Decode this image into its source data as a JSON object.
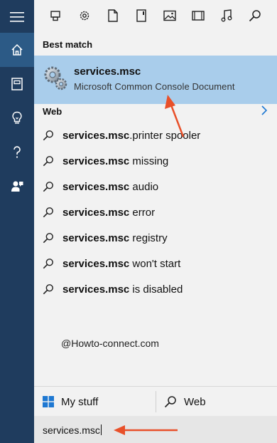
{
  "rail": {
    "items": [
      {
        "icon": "hamburger-menu-icon"
      },
      {
        "icon": "home-icon"
      },
      {
        "icon": "notebook-icon"
      },
      {
        "icon": "lightbulb-icon"
      },
      {
        "icon": "help-icon"
      },
      {
        "icon": "feedback-icon"
      }
    ]
  },
  "filters": [
    "apps-icon",
    "settings-icon",
    "documents-icon",
    "folders-icon",
    "photos-icon",
    "videos-icon",
    "music-icon",
    "search-icon"
  ],
  "best_match": {
    "label": "Best match",
    "title": "services.msc",
    "subtitle": "Microsoft Common Console Document"
  },
  "web": {
    "label": "Web",
    "suggestions": [
      {
        "bold": "services.msc",
        "rest": ".printer spooler"
      },
      {
        "bold": "services.msc",
        "rest": " missing"
      },
      {
        "bold": "services.msc",
        "rest": " audio"
      },
      {
        "bold": "services.msc",
        "rest": " error"
      },
      {
        "bold": "services.msc",
        "rest": " registry"
      },
      {
        "bold": "services.msc",
        "rest": " won't start"
      },
      {
        "bold": "services.msc",
        "rest": " is disabled"
      }
    ]
  },
  "watermark": "@Howto-connect.com",
  "tabs": {
    "mystuff": "My stuff",
    "web": "Web"
  },
  "search": {
    "value": "services.msc"
  },
  "colors": {
    "rail": "#1f3c5e",
    "rail_active": "#2c5a86",
    "highlight": "#a9cdeb",
    "annotation_arrow": "#e8502a",
    "accent": "#1e78d2"
  }
}
